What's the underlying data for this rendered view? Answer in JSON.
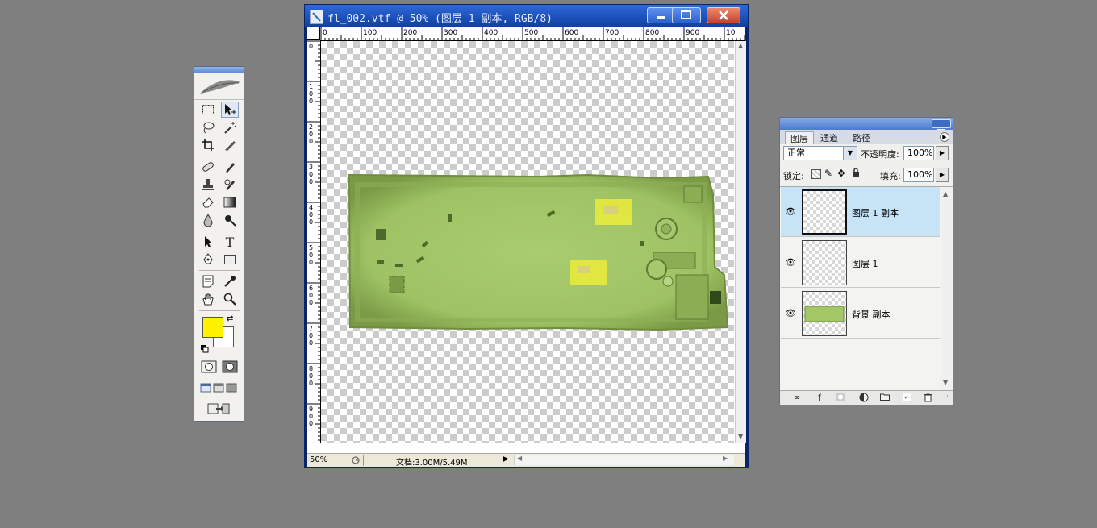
{
  "toolbox": {
    "tools": [
      "marquee",
      "move",
      "lasso",
      "magic-wand",
      "crop",
      "slice",
      "healing-brush",
      "brush",
      "clone-stamp",
      "history-brush",
      "eraser",
      "gradient",
      "blur",
      "dodge",
      "path-selection",
      "type",
      "pen",
      "shape",
      "notes",
      "eyedropper",
      "hand",
      "zoom"
    ],
    "type_tool_glyph": "T",
    "foreground_color": "#fff200",
    "background_color": "#ffffff"
  },
  "document": {
    "title": "fl_002.vtf @ 50% (图层 1 副本, RGB/8)",
    "ruler_h": [
      "0",
      "100",
      "200",
      "300",
      "400",
      "500",
      "600",
      "700",
      "800",
      "900",
      "10"
    ],
    "ruler_v": [
      "0",
      "1\n0\n0",
      "2\n0\n0",
      "3\n0\n0",
      "4\n0\n0",
      "5\n0\n0",
      "6\n0\n0",
      "7\n0\n0",
      "8\n0\n0",
      "9\n0\n0",
      "1"
    ],
    "zoom": "50%",
    "doc_info": "文档:3.00M/5.49M"
  },
  "layers_panel": {
    "tabs": [
      "图层",
      "通道",
      "路径"
    ],
    "blend_mode": "正常",
    "opacity_label": "不透明度:",
    "opacity_value": "100%",
    "lock_label": "锁定:",
    "fill_label": "填充:",
    "fill_value": "100%",
    "layers": [
      {
        "name": "图层 1 副本",
        "selected": true
      },
      {
        "name": "图层 1",
        "selected": false
      },
      {
        "name": "背景 副本",
        "selected": false
      }
    ]
  },
  "colors": {
    "map_green": "#a3c667",
    "map_dark": "#5f7a35",
    "map_yellow": "#e6ea3c",
    "accent_blue": "#1b4fb8"
  }
}
